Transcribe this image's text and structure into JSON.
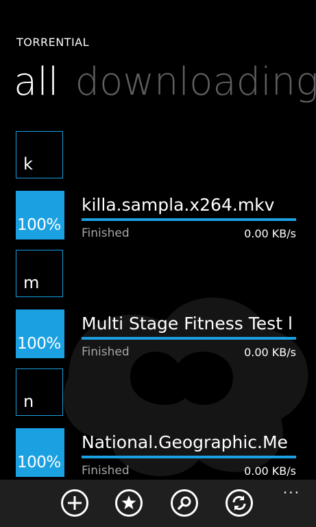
{
  "app": {
    "title": "TORRENTIAL"
  },
  "pivot": {
    "active": "all",
    "next": "downloading"
  },
  "groups": [
    {
      "letter": "k"
    },
    {
      "letter": "m"
    },
    {
      "letter": "n"
    }
  ],
  "torrents": [
    {
      "progress_label": "100%",
      "progress": 1.0,
      "name": "killa.sampla.x264.mkv",
      "status": "Finished",
      "speed": "0.00 KB/s"
    },
    {
      "progress_label": "100%",
      "progress": 1.0,
      "name": "Multi Stage Fitness Test l",
      "status": "Finished",
      "speed": "0.00 KB/s"
    },
    {
      "progress_label": "100%",
      "progress": 1.0,
      "name": "National.Geographic.Me",
      "status": "Finished",
      "speed": "0.00 KB/s"
    }
  ],
  "appbar": {
    "buttons": [
      "add-icon",
      "star-icon",
      "search-icon",
      "refresh-icon"
    ],
    "more": "..."
  },
  "colors": {
    "accent": "#1ba1e2",
    "background": "#000000",
    "appbar": "#1f1f1f"
  }
}
